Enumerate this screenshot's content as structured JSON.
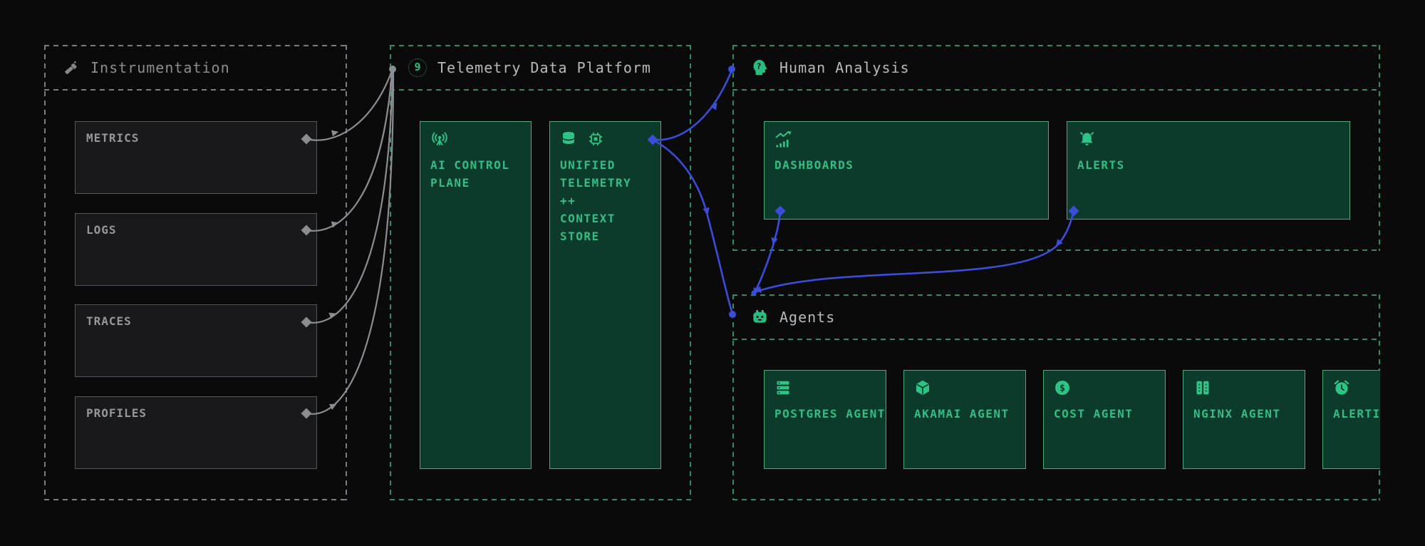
{
  "diagram": {
    "background": "#0a0a0b",
    "colors": {
      "green_text": "#33bd86",
      "green_border": "#4aa87d",
      "green_fill": "#0d3b2b",
      "green_dashed": "#2d8a64",
      "gray_text": "#96979a",
      "gray_border": "#54565b",
      "gray_dashed": "#7b7d82",
      "header_text": "#b7babc",
      "blue_connector": "#3b4dd8",
      "gray_connector": "#8c8d90"
    },
    "icons": {
      "nine_glyph": "9",
      "question_glyph": "?",
      "dollar_glyph": "$"
    },
    "sections": {
      "instrumentation": {
        "title": "Instrumentation",
        "icon": "telescope-icon",
        "nodes": [
          {
            "label": "METRICS"
          },
          {
            "label": "LOGS"
          },
          {
            "label": "TRACES"
          },
          {
            "label": "PROFILES"
          }
        ]
      },
      "telemetry": {
        "title": "Telemetry Data Platform",
        "icon": "nine-badge-icon",
        "nodes": [
          {
            "label": "AI CONTROL\nPLANE",
            "icons": [
              "broadcast-antenna-icon"
            ]
          },
          {
            "label": "UNIFIED\nTELEMETRY\n++\nCONTEXT\nSTORE",
            "icons": [
              "database-icon",
              "cpu-chip-icon"
            ]
          }
        ]
      },
      "human_analysis": {
        "title": "Human Analysis",
        "icon": "head-question-icon",
        "nodes": [
          {
            "label": "DASHBOARDS",
            "icon": "line-chart-icon"
          },
          {
            "label": "ALERTS",
            "icon": "bell-icon"
          }
        ]
      },
      "agents": {
        "title": "Agents",
        "icon": "robot-icon",
        "nodes": [
          {
            "label": "POSTGRES AGENT",
            "icon": "server-stack-icon"
          },
          {
            "label": "AKAMAI AGENT",
            "icon": "cube-icon"
          },
          {
            "label": "COST AGENT",
            "icon": "dollar-circle-icon"
          },
          {
            "label": "NGINX AGENT",
            "icon": "server-rack-icon"
          },
          {
            "label": "ALERTING AGENT",
            "icon": "alarm-clock-icon"
          }
        ]
      }
    },
    "connectors": {
      "gray": [
        {
          "from": "METRICS",
          "to": "Telemetry Data Platform"
        },
        {
          "from": "LOGS",
          "to": "Telemetry Data Platform"
        },
        {
          "from": "TRACES",
          "to": "Telemetry Data Platform"
        },
        {
          "from": "PROFILES",
          "to": "Telemetry Data Platform"
        }
      ],
      "blue": [
        {
          "from": "UNIFIED TELEMETRY ++ CONTEXT STORE",
          "to": "Human Analysis"
        },
        {
          "from": "UNIFIED TELEMETRY ++ CONTEXT STORE",
          "to": "Agents"
        },
        {
          "from": "DASHBOARDS",
          "to": "Agents"
        },
        {
          "from": "ALERTS",
          "to": "Agents"
        }
      ]
    }
  }
}
